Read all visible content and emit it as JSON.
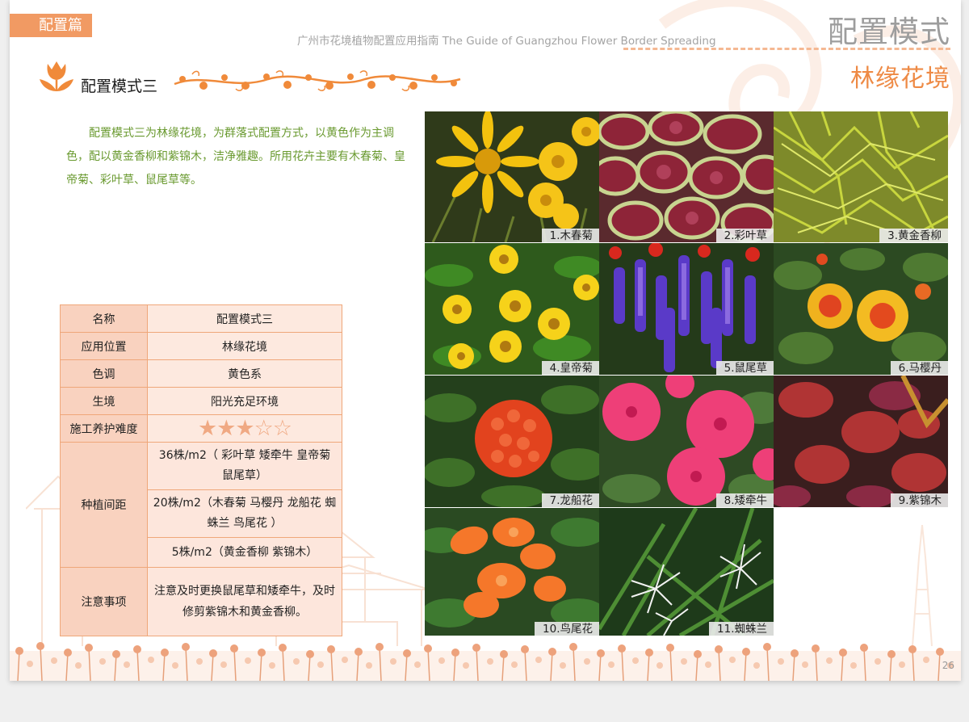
{
  "header": {
    "chapter_tag": "配置篇",
    "guide_title": "广州市花境植物配置应用指南 The Guide of Guangzhou Flower Border Spreading",
    "mode_title": "配置模式",
    "sub_title": "林缘花境"
  },
  "section": {
    "title": "配置模式三",
    "description": "配置模式三为林缘花境，为群落式配置方式，以黄色作为主调色，配以黄金香柳和紫锦木，洁净雅趣。所用花卉主要有木春菊、皇帝菊、彩叶草、鼠尾草等。"
  },
  "table": {
    "name_label": "名称",
    "name_value": "配置模式三",
    "position_label": "应用位置",
    "position_value": "林缘花境",
    "tone_label": "色调",
    "tone_value": "黄色系",
    "habitat_label": "生境",
    "habitat_value": "阳光充足环境",
    "difficulty_label": "施工养护难度",
    "difficulty_stars": "★★★☆☆",
    "difficulty_rating": 3,
    "difficulty_max": 5,
    "spacing_label": "种植间距",
    "spacing_rows": [
      "36株/m2（ 彩叶草 矮牵牛 皇帝菊 鼠尾草）",
      "20株/m2（木春菊 马樱丹 龙船花 蜘蛛兰 鸟尾花 ）",
      "5株/m2（黄金香柳 紫锦木）"
    ],
    "note_label": "注意事项",
    "note_value": "注意及时更换鼠尾草和矮牵牛，及时修剪紫锦木和黄金香柳。"
  },
  "plants": [
    {
      "caption": "1.木春菊",
      "icon": "yellow-daisy-photo"
    },
    {
      "caption": "2.彩叶草",
      "icon": "coleus-photo"
    },
    {
      "caption": "3.黄金香柳",
      "icon": "golden-willow-photo"
    },
    {
      "caption": "4.皇帝菊",
      "icon": "melampodium-photo"
    },
    {
      "caption": "5.鼠尾草",
      "icon": "salvia-photo"
    },
    {
      "caption": "6.马樱丹",
      "icon": "lantana-photo"
    },
    {
      "caption": "7.龙船花",
      "icon": "ixora-photo"
    },
    {
      "caption": "8.矮牵牛",
      "icon": "petunia-photo"
    },
    {
      "caption": "9.紫锦木",
      "icon": "purple-leaf-photo"
    },
    {
      "caption": "10.鸟尾花",
      "icon": "crossandra-photo"
    },
    {
      "caption": "11.蜘蛛兰",
      "icon": "spider-lily-photo"
    }
  ],
  "page_number": "26",
  "colors": {
    "accent_orange": "#f19a63",
    "title_orange": "#ee8a45",
    "desc_green": "#6a9a30",
    "table_border": "#efa77a",
    "table_key_bg": "#f9d2bf",
    "table_val_bg": "#fde9df"
  }
}
